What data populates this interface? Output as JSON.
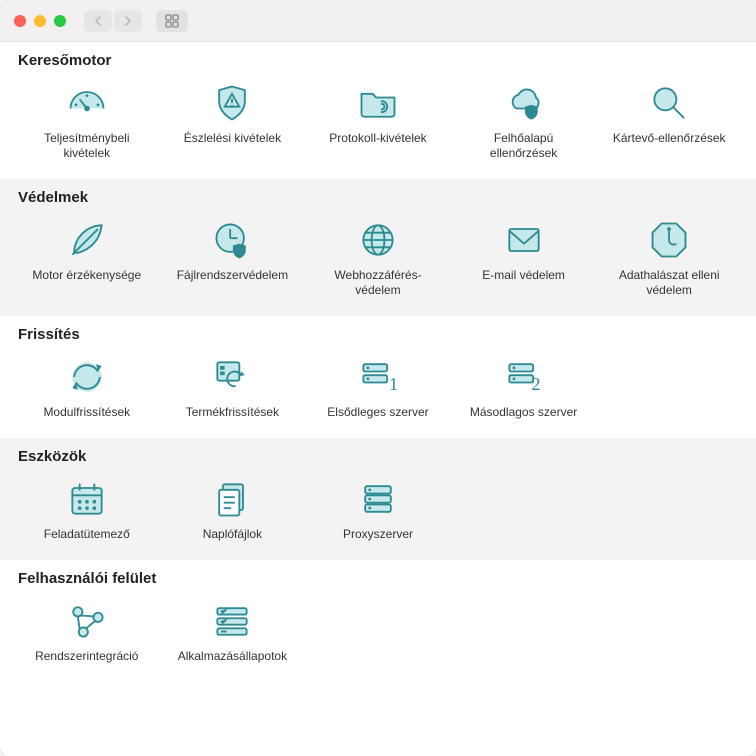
{
  "sections": [
    {
      "title": "Keresőmotor",
      "alt": false,
      "items": [
        {
          "icon": "gauge",
          "label": "Teljesítménybeli kivételek"
        },
        {
          "icon": "shield-warn",
          "label": "Észlelési kivételek"
        },
        {
          "icon": "folder-wave",
          "label": "Protokoll-kivételek"
        },
        {
          "icon": "cloud-shield",
          "label": "Felhőalapú ellenőrzések"
        },
        {
          "icon": "magnify",
          "label": "Kártevő-ellenőrzések"
        }
      ]
    },
    {
      "title": "Védelmek",
      "alt": true,
      "items": [
        {
          "icon": "feather",
          "label": "Motor érzékenysége"
        },
        {
          "icon": "clock-shield",
          "label": "Fájlrendszervédelem"
        },
        {
          "icon": "globe",
          "label": "Webhozzáférés-védelem"
        },
        {
          "icon": "mail",
          "label": "E-mail védelem"
        },
        {
          "icon": "phishing",
          "label": "Adathalászat elleni védelem"
        }
      ]
    },
    {
      "title": "Frissítés",
      "alt": false,
      "items": [
        {
          "icon": "module-update",
          "label": "Modulfrissítések"
        },
        {
          "icon": "product-update",
          "label": "Termékfrissítések"
        },
        {
          "icon": "server1",
          "label": "Elsődleges szerver"
        },
        {
          "icon": "server2",
          "label": "Másodlagos szerver"
        }
      ]
    },
    {
      "title": "Eszközök",
      "alt": true,
      "items": [
        {
          "icon": "calendar",
          "label": "Feladatütemező"
        },
        {
          "icon": "logs",
          "label": "Naplófájlok"
        },
        {
          "icon": "proxy",
          "label": "Proxyszerver"
        }
      ]
    },
    {
      "title": "Felhasználói felület",
      "alt": false,
      "items": [
        {
          "icon": "integration",
          "label": "Rendszerintegráció"
        },
        {
          "icon": "app-status",
          "label": "Alkalmazásállapotok"
        }
      ]
    }
  ]
}
